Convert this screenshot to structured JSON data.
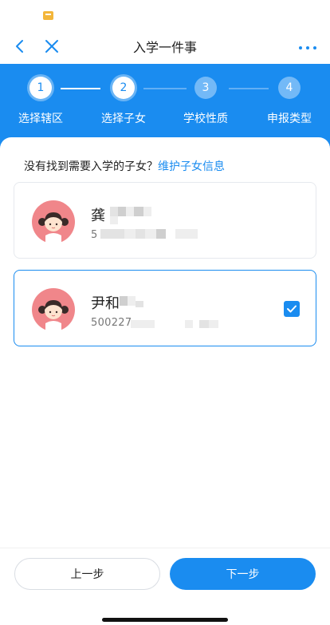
{
  "nav": {
    "title": "入学一件事"
  },
  "steps": [
    {
      "number": "1",
      "label": "选择辖区",
      "state": "active"
    },
    {
      "number": "2",
      "label": "选择子女",
      "state": "active"
    },
    {
      "number": "3",
      "label": "学校性质",
      "state": "inactive"
    },
    {
      "number": "4",
      "label": "申报类型",
      "state": "inactive"
    }
  ],
  "hint": {
    "text": "没有找到需要入学的子女？",
    "link": "维护子女信息"
  },
  "children": [
    {
      "name": "龚",
      "id": "5",
      "selected": false
    },
    {
      "name": "尹和",
      "id": "500227",
      "selected": true
    }
  ],
  "footer": {
    "prev_label": "上一步",
    "next_label": "下一步"
  },
  "icons": {
    "back": "chevron-left-icon",
    "close": "close-icon",
    "more": "more-dots-icon",
    "check": "checkmark-icon"
  },
  "colors": {
    "primary": "#1a8cf0",
    "step_inactive": "#73b9f7",
    "avatar_bg": "#f0868a"
  }
}
